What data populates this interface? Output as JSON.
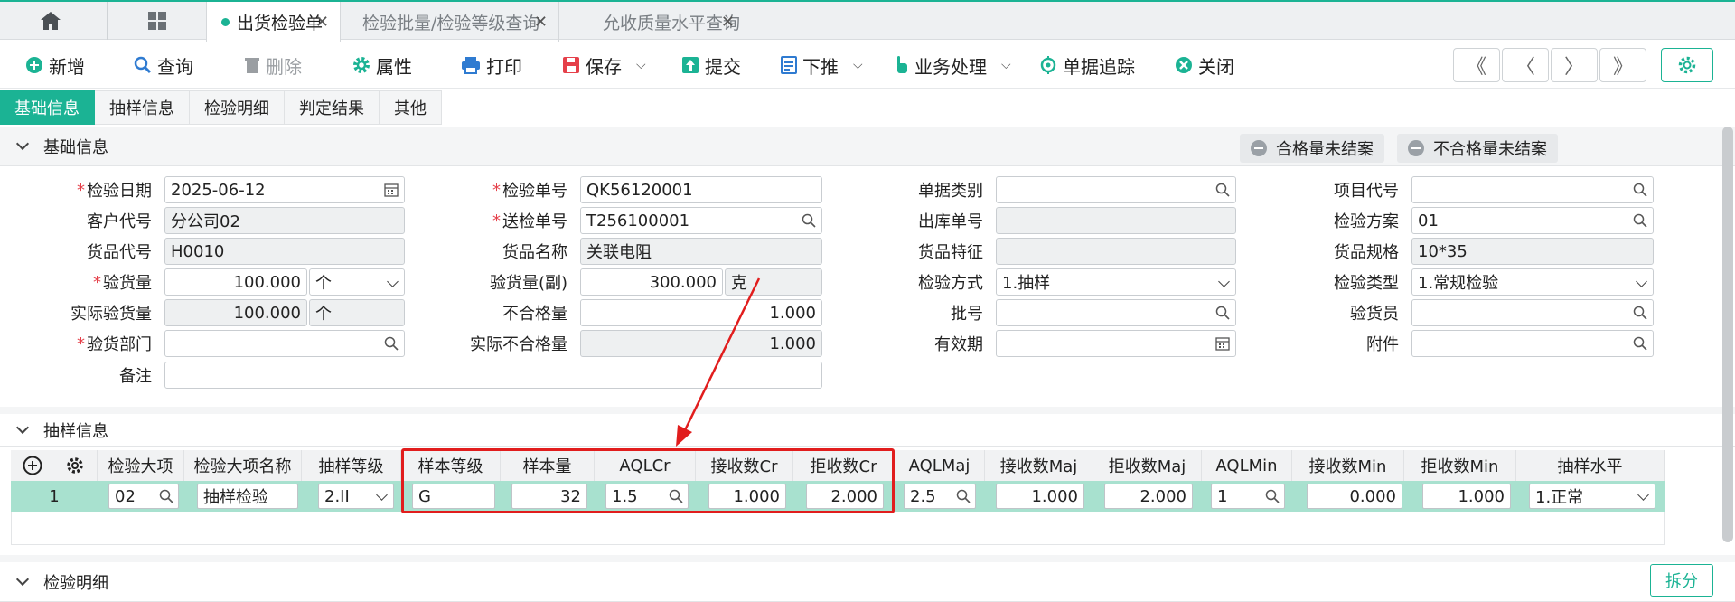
{
  "tabs": {
    "doc_tabs": [
      {
        "label": "出货检验单",
        "close": "✕"
      },
      {
        "label": "检验批量/检验等级查询",
        "close": "✕"
      },
      {
        "label": "允收质量水平查询",
        "close": "✕"
      }
    ]
  },
  "toolbar": {
    "new": "新增",
    "query": "查询",
    "delete": "删除",
    "props": "属性",
    "print": "打印",
    "save": "保存",
    "submit": "提交",
    "push_down": "下推",
    "business": "业务处理",
    "trace": "单据追踪",
    "close": "关闭",
    "nav": [
      "《",
      "〈",
      "〉",
      "》"
    ]
  },
  "subtabs": [
    "基础信息",
    "抽样信息",
    "检验明细",
    "判定结果",
    "其他"
  ],
  "sections": {
    "basic": "基础信息",
    "sampling": "抽样信息",
    "detail": "检验明细"
  },
  "pills": {
    "qualified": "合格量未结案",
    "unqualified": "不合格量未结案"
  },
  "form": {
    "inspect_date": {
      "label": "检验日期",
      "value": "2025-06-12"
    },
    "inspect_no": {
      "label": "检验单号",
      "value": "QK56120001"
    },
    "doc_type": {
      "label": "单据类别",
      "value": ""
    },
    "project_code": {
      "label": "项目代号",
      "value": ""
    },
    "customer_code": {
      "label": "客户代号",
      "value": "分公司02"
    },
    "submit_no": {
      "label": "送检单号",
      "value": "T256100001"
    },
    "out_no": {
      "label": "出库单号",
      "value": ""
    },
    "plan": {
      "label": "检验方案",
      "value": "01"
    },
    "item_code": {
      "label": "货品代号",
      "value": "H0010"
    },
    "item_name": {
      "label": "货品名称",
      "value": "关联电阻"
    },
    "item_feature": {
      "label": "货品特征",
      "value": ""
    },
    "item_spec": {
      "label": "货品规格",
      "value": "10*35"
    },
    "qty": {
      "label": "验货量",
      "value": "100.000",
      "unit": "个"
    },
    "qty2": {
      "label": "验货量(副)",
      "value": "300.000",
      "unit": "克"
    },
    "method": {
      "label": "检验方式",
      "value": "1.抽样"
    },
    "type": {
      "label": "检验类型",
      "value": "1.常规检验"
    },
    "actual_qty": {
      "label": "实际验货量",
      "value": "100.000",
      "unit": "个"
    },
    "bad_qty": {
      "label": "不合格量",
      "value": "1.000"
    },
    "batch": {
      "label": "批号",
      "value": ""
    },
    "inspector": {
      "label": "验货员",
      "value": ""
    },
    "dept": {
      "label": "验货部门",
      "value": ""
    },
    "actual_bad": {
      "label": "实际不合格量",
      "value": "1.000"
    },
    "expiry": {
      "label": "有效期",
      "value": ""
    },
    "attach": {
      "label": "附件",
      "value": ""
    },
    "remark": {
      "label": "备注",
      "value": ""
    }
  },
  "grid": {
    "headers": [
      "检验大项",
      "检验大项名称",
      "抽样等级",
      "样本等级",
      "样本量",
      "AQLCr",
      "接收数Cr",
      "拒收数Cr",
      "AQLMaj",
      "接收数Maj",
      "拒收数Maj",
      "AQLMin",
      "接收数Min",
      "拒收数Min",
      "抽样水平"
    ],
    "row": {
      "index": "1",
      "item": "02",
      "item_name": "抽样检验",
      "sample_level": "2.II",
      "sample_grade": "G",
      "sample_size": "32",
      "aql_cr": "1.5",
      "accept_cr": "1.000",
      "reject_cr": "2.000",
      "aql_maj": "2.5",
      "accept_maj": "1.000",
      "reject_maj": "2.000",
      "aql_min": "1",
      "accept_min": "0.000",
      "reject_min": "1.000",
      "level": "1.正常"
    }
  },
  "split_button": "拆分",
  "colors": {
    "accent": "#1bb394",
    "highlight": "#e11d1d",
    "row": "#a8e1cf"
  }
}
